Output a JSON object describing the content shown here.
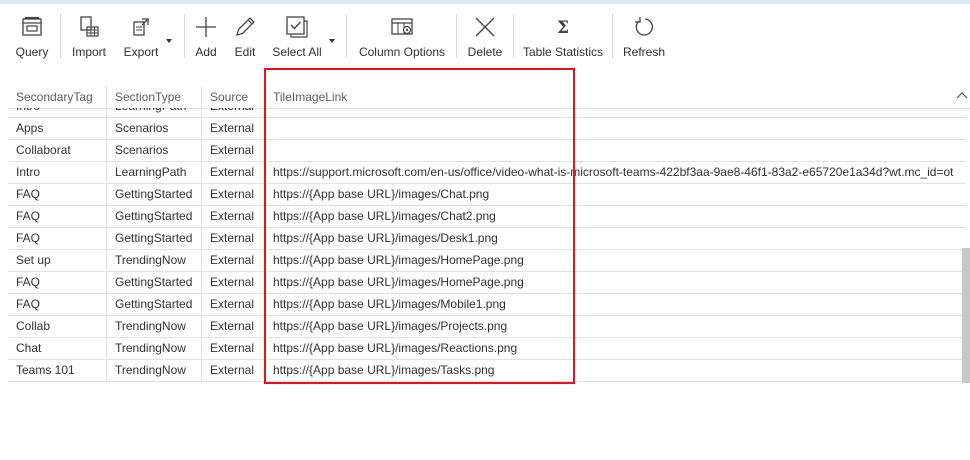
{
  "toolbar": {
    "query": "Query",
    "import": "Import",
    "export": "Export",
    "add": "Add",
    "edit": "Edit",
    "select_all": "Select All",
    "column_options": "Column Options",
    "delete": "Delete",
    "table_statistics": "Table Statistics",
    "refresh": "Refresh"
  },
  "columns": [
    "SecondaryTag",
    "SectionType",
    "Source",
    "TileImageLink"
  ],
  "rows": [
    [
      "Intro",
      "LearningPath",
      "External",
      ""
    ],
    [
      "Apps",
      "Scenarios",
      "External",
      ""
    ],
    [
      "Collaborat",
      "Scenarios",
      "External",
      ""
    ],
    [
      "Intro",
      "LearningPath",
      "External",
      "https://support.microsoft.com/en-us/office/video-what-is-microsoft-teams-422bf3aa-9ae8-46f1-83a2-e65720e1a34d?wt.mc_id=ot"
    ],
    [
      "FAQ",
      "GettingStarted",
      "External",
      "https://{App base URL}/images/Chat.png"
    ],
    [
      "FAQ",
      "GettingStarted",
      "External",
      "https://{App base URL}/images/Chat2.png"
    ],
    [
      "FAQ",
      "GettingStarted",
      "External",
      "https://{App base URL}/images/Desk1.png"
    ],
    [
      "Set up",
      "TrendingNow",
      "External",
      "https://{App base URL}/images/HomePage.png"
    ],
    [
      "FAQ",
      "GettingStarted",
      "External",
      "https://{App base URL}/images/HomePage.png"
    ],
    [
      "FAQ",
      "GettingStarted",
      "External",
      "https://{App base URL}/images/Mobile1.png"
    ],
    [
      "Collab",
      "TrendingNow",
      "External",
      "https://{App base URL}/images/Projects.png"
    ],
    [
      "Chat",
      "TrendingNow",
      "External",
      "https://{App base URL}/images/Reactions.png"
    ],
    [
      "Teams 101",
      "TrendingNow",
      "External",
      "https://{App base URL}/images/Tasks.png"
    ]
  ],
  "colors": {
    "highlight": "#e81123",
    "grid": "#e1e1e1",
    "text": "#323130"
  },
  "icons": [
    "query-icon",
    "import-icon",
    "export-icon",
    "add-icon",
    "edit-icon",
    "select-all-icon",
    "column-options-icon",
    "delete-icon",
    "table-statistics-icon",
    "refresh-icon"
  ]
}
